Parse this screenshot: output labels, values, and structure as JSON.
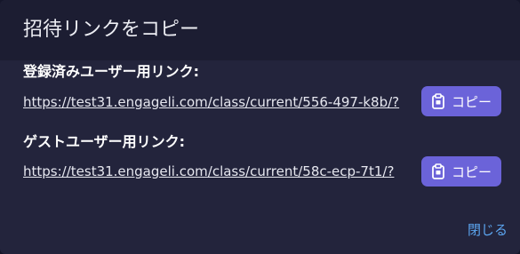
{
  "dialog": {
    "title": "招待リンクをコピー",
    "close_label": "閉じる"
  },
  "links": [
    {
      "label": "登録済みユーザー用リンク:",
      "url": "https://test31.engageli.com/class/current/556-497-k8b/?",
      "copy_label": "コピー",
      "copy_icon": "clipboard-icon"
    },
    {
      "label": "ゲストユーザー用リンク:",
      "url": "https://test31.engageli.com/class/current/58c-ecp-7t1/?",
      "copy_label": "コピー",
      "copy_icon": "clipboard-icon"
    }
  ],
  "colors": {
    "accent": "#6b63d9",
    "link": "#5ba4ee",
    "background": "#23243c"
  }
}
